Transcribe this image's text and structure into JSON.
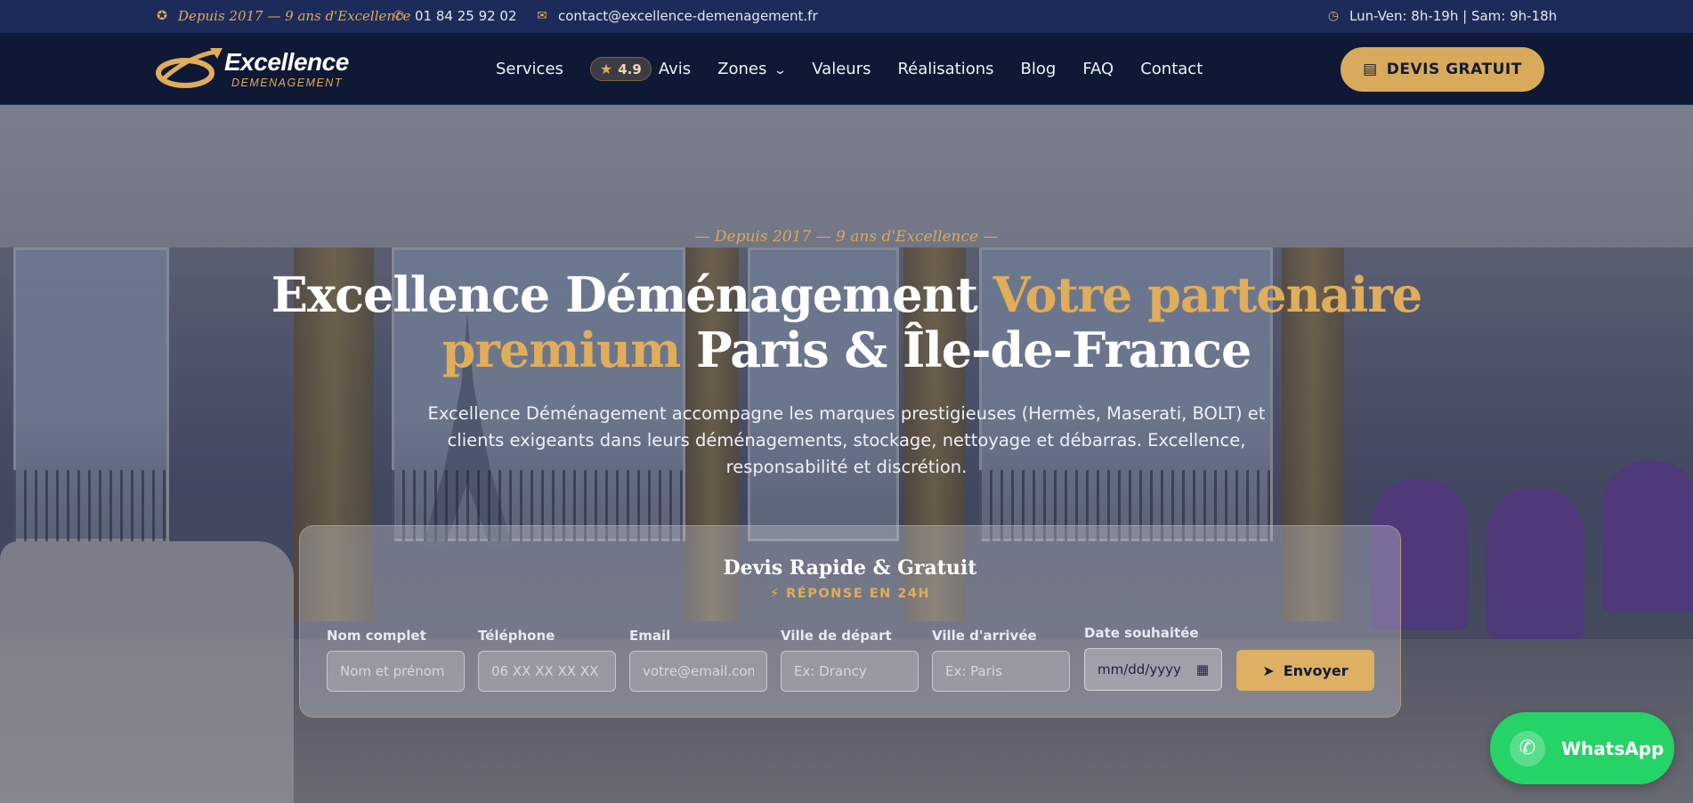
{
  "topbar": {
    "tagline": "Depuis 2017 — 9 ans d'Excellence",
    "phone": "01 84 25 92 02",
    "email": "contact@excellence-demenagement.fr",
    "hours": "Lun-Ven: 8h-19h | Sam: 9h-18h"
  },
  "brand": {
    "name": "Excellence",
    "sub": "DEMENAGEMENT"
  },
  "nav": {
    "services": "Services",
    "rating": "4.9",
    "avis": "Avis",
    "zones": "Zones",
    "valeurs": "Valeurs",
    "realisations": "Réalisations",
    "blog": "Blog",
    "faq": "FAQ",
    "contact": "Contact",
    "cta": "DEVIS GRATUIT"
  },
  "hero": {
    "tag": "— Depuis 2017 — 9 ans d'Excellence —",
    "title_part1": "Excellence Déménagement ",
    "title_gold": "Votre partenaire premium",
    "title_part2": " Paris & Île-de-France",
    "description": "Excellence Déménagement accompagne les marques prestigieuses (Hermès, Maserati, BOLT) et clients exigeants dans leurs déménagements, stockage, nettoyage et débarras. Excellence, responsabilité et discrétion."
  },
  "form": {
    "title": "Devis Rapide & Gratuit",
    "subtitle": "RÉPONSE EN 24H",
    "fields": [
      {
        "label": "Nom complet",
        "placeholder": "Nom et prénom"
      },
      {
        "label": "Téléphone",
        "placeholder": "06 XX XX XX XX"
      },
      {
        "label": "Email",
        "placeholder": "votre@email.com"
      },
      {
        "label": "Ville de départ",
        "placeholder": "Ex: Drancy"
      },
      {
        "label": "Ville d'arrivée",
        "placeholder": "Ex: Paris"
      }
    ],
    "date_label": "Date souhaitée",
    "date_value": "mm/dd/yyyy",
    "submit": "Envoyer"
  },
  "whatsapp": {
    "label": "WhatsApp"
  },
  "colors": {
    "gold": "#e0ad5a",
    "navy": "#0f1835",
    "topbar": "#1c2b5a",
    "whatsapp": "#25d366"
  }
}
